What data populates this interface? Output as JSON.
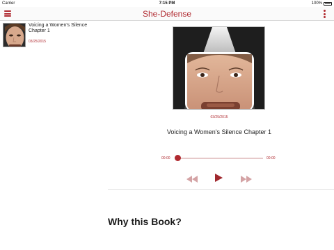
{
  "status_bar": {
    "carrier": "Carrier",
    "time": "7:15 PM",
    "battery": "100%"
  },
  "nav": {
    "title": "She-Defense",
    "menu_icon": "hamburger-menu-icon",
    "more_icon": "vertical-ellipsis-icon"
  },
  "sidebar": {
    "items": [
      {
        "title": "Voicing a Women's Silence Chapter 1",
        "date": "03/25/2015"
      }
    ]
  },
  "episode": {
    "date": "03/25/2015",
    "title": "Voicing a Women's Silence Chapter 1"
  },
  "player": {
    "current_time": "00:00",
    "duration": "00:00",
    "progress": 0,
    "rewind_icon": "rewind-icon",
    "play_icon": "play-icon",
    "forward_icon": "fast-forward-icon"
  },
  "section": {
    "title": "Why this Book?"
  },
  "colors": {
    "accent": "#b02a30",
    "accent_light": "#e6c9ca"
  }
}
